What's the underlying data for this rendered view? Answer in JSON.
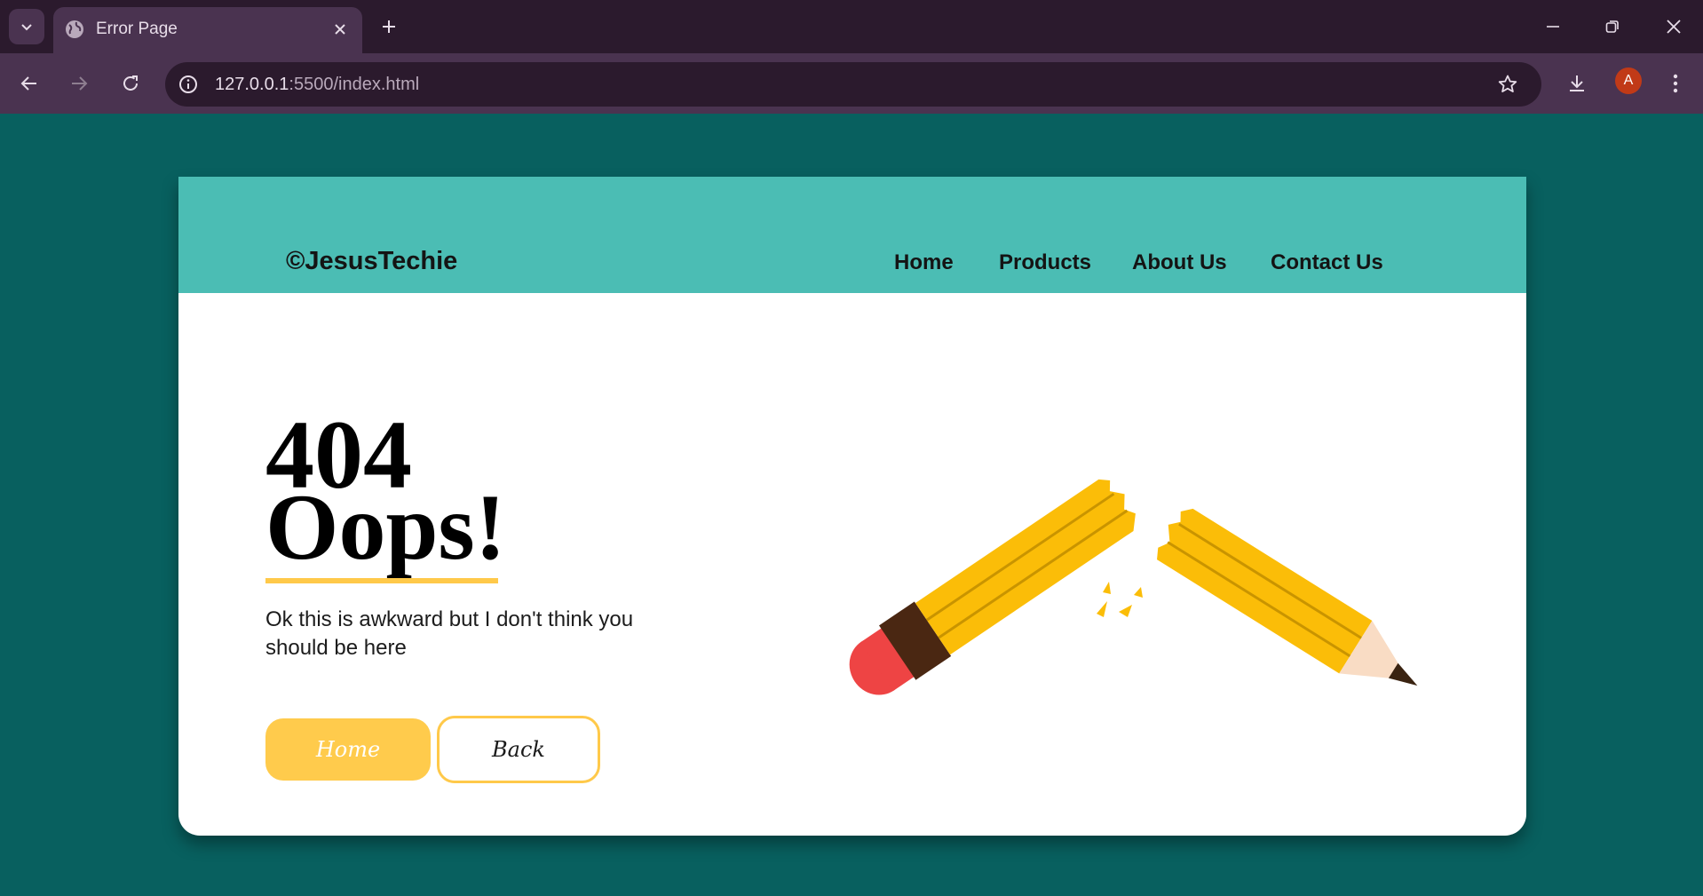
{
  "browser": {
    "tab_title": "Error Page",
    "url_host": "127.0.0.1",
    "url_rest": ":5500/index.html",
    "profile_initial": "A"
  },
  "site": {
    "brand": "©JesusTechie",
    "nav": [
      "Home",
      "Products",
      "About Us",
      "Contact Us"
    ]
  },
  "error": {
    "code": "404",
    "headline": "Oops!",
    "message": "Ok this is awkward but I don't think you should be here",
    "home_button": "Home",
    "back_button": "Back"
  },
  "colors": {
    "page_background": "#08605f",
    "header": "#4bbdb4",
    "accent": "#ffc94a",
    "pencil": "#fbbd08",
    "eraser": "#ee4444"
  }
}
